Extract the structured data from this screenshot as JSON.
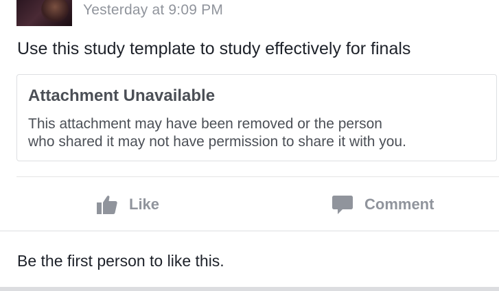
{
  "post": {
    "timestamp": "Yesterday at 9:09 PM",
    "text": "Use this study template to study effectively for finals"
  },
  "attachment": {
    "title": "Attachment Unavailable",
    "body_line1": "This attachment may have been removed or the person",
    "body_line2": "who shared it may not have permission to share it with you."
  },
  "actions": {
    "like_label": "Like",
    "like_icon": "thumbs-up-icon",
    "comment_label": "Comment",
    "comment_icon": "speech-bubble-icon"
  },
  "reactions": {
    "summary": "Be the first person to like this."
  },
  "colors": {
    "text_primary": "#1d2129",
    "text_secondary": "#90949c",
    "attachment_text": "#4b4f56",
    "border": "#dddfe2"
  }
}
